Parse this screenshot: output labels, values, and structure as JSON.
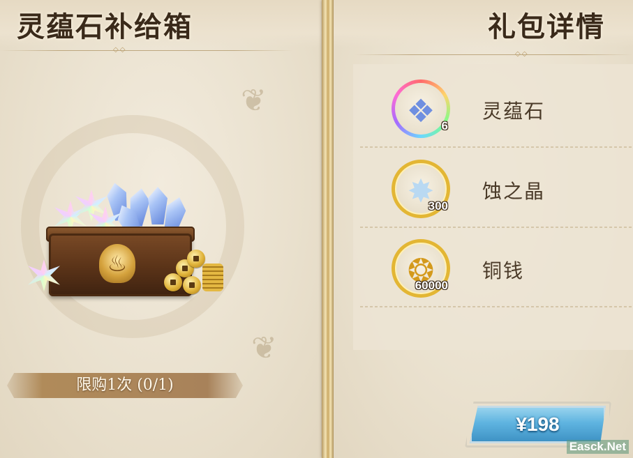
{
  "left_panel": {
    "title": "灵蕴石补给箱",
    "limit_text": "限购1次 (0/1)"
  },
  "right_panel": {
    "title": "礼包详情",
    "items": [
      {
        "name": "灵蕴石",
        "quantity": "6",
        "icon": "spirit-stone-crystal-icon",
        "frame_color": "rainbow"
      },
      {
        "name": "蚀之晶",
        "quantity": "300",
        "icon": "erosion-crystal-star-icon",
        "frame_color": "#e3b634"
      },
      {
        "name": "铜钱",
        "quantity": "60000",
        "icon": "copper-coins-icon",
        "frame_color": "#e3b634"
      }
    ],
    "price_label": "¥198"
  },
  "watermark": "Easck.Net",
  "colors": {
    "title_text": "#3a2a1a",
    "limit_bar": "#a8825a",
    "price_button": "#5fb4e0",
    "gold_frame": "#e3b634"
  }
}
